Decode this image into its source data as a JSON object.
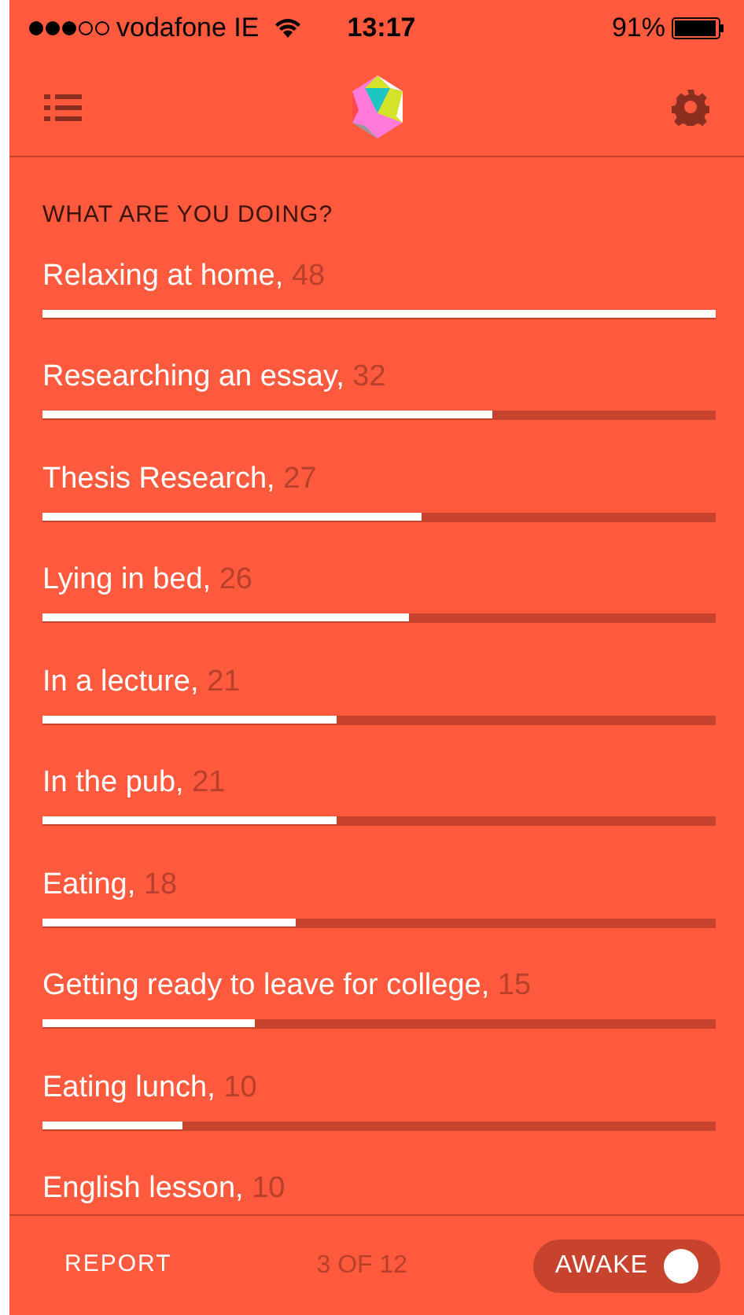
{
  "status_bar": {
    "carrier": "vodafone IE",
    "time": "13:17",
    "battery": "91%"
  },
  "heading": "WHAT ARE YOU DOING?",
  "activities": [
    {
      "label": "Relaxing at home,",
      "count": "48",
      "level": 1
    },
    {
      "label": "Researching an essay,",
      "count": "32",
      "level": 0.668
    },
    {
      "label": "Thesis Research,",
      "count": "27",
      "level": 0.563
    },
    {
      "label": "Lying in bed,",
      "count": "26",
      "level": 0.544
    },
    {
      "label": "In a lecture,",
      "count": "21",
      "level": 0.437
    },
    {
      "label": "In the pub,",
      "count": "21",
      "level": 0.437
    },
    {
      "label": "Eating,",
      "count": "18",
      "level": 0.376
    },
    {
      "label": "Getting ready to leave for college,",
      "count": "15",
      "level": 0.315
    },
    {
      "label": "Eating lunch,",
      "count": "10",
      "level": 0.208
    },
    {
      "label": "English lesson,",
      "count": "10"
    }
  ],
  "footer": {
    "report": "REPORT",
    "page": "3 OF 12",
    "toggle": {
      "label": "AWAKE",
      "on": true
    }
  }
}
